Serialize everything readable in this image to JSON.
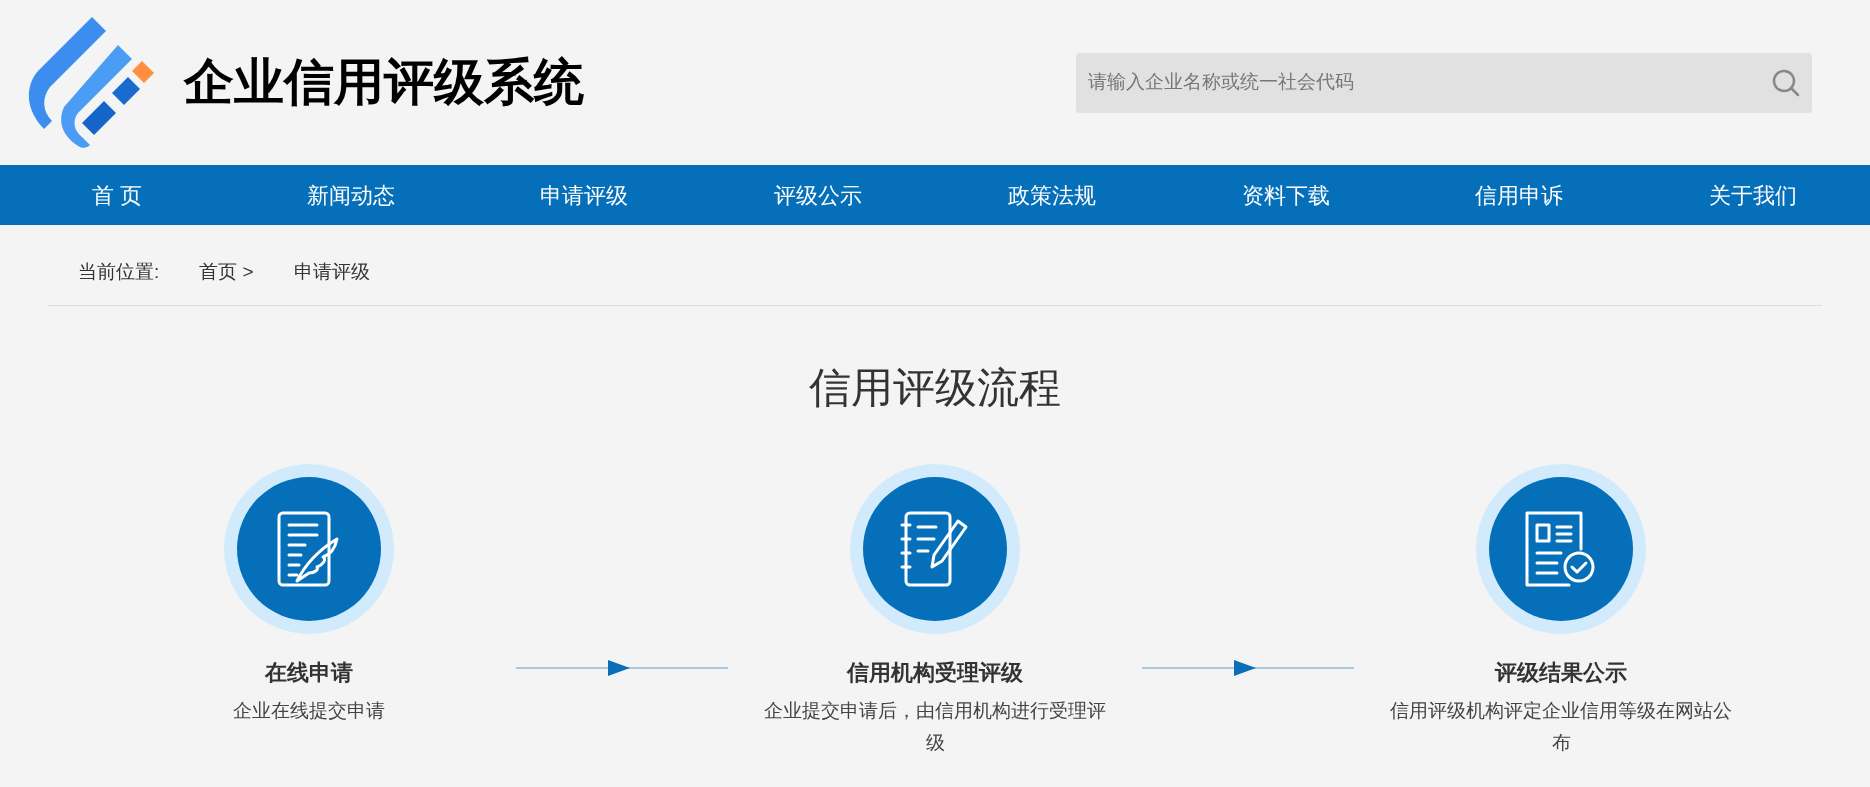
{
  "header": {
    "title": "企业信用评级系统",
    "search": {
      "placeholder": "请输入企业名称或统一社会代码"
    }
  },
  "nav": [
    {
      "label": "首 页"
    },
    {
      "label": "新闻动态"
    },
    {
      "label": "申请评级"
    },
    {
      "label": "评级公示"
    },
    {
      "label": "政策法规"
    },
    {
      "label": "资料下载"
    },
    {
      "label": "信用申诉"
    },
    {
      "label": "关于我们"
    }
  ],
  "breadcrumb": {
    "label": "当前位置:",
    "items": [
      "首页 >",
      "申请评级"
    ]
  },
  "process": {
    "title": "信用评级流程",
    "steps": [
      {
        "kind": "application",
        "title": "在线申请",
        "description": "企业在线提交申请"
      },
      {
        "kind": "review",
        "title": "信用机构受理评级",
        "description": "企业提交申请后，由信用机构进行受理评级"
      },
      {
        "kind": "publish",
        "title": "评级结果公示",
        "description": "信用评级机构评定企业信用等级在网站公布"
      }
    ]
  }
}
